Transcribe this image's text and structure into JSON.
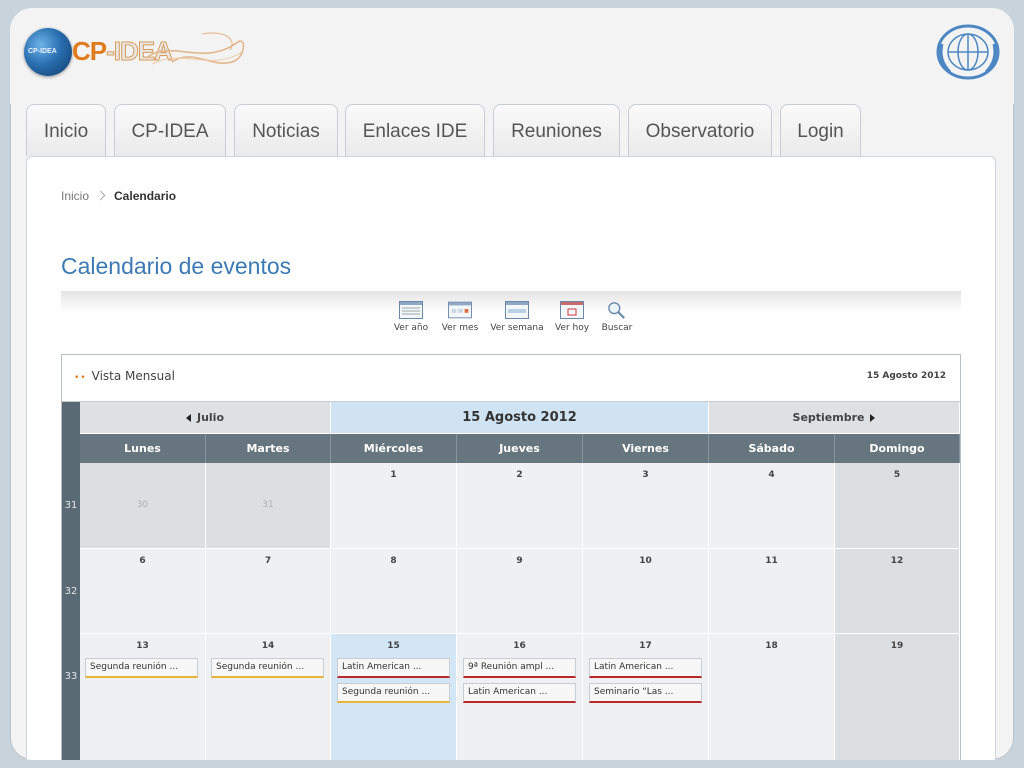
{
  "logo": {
    "globe_text": "CP-IDEA",
    "text_a": "CP",
    "text_b": "-IDEA"
  },
  "nav_tabs": [
    "Inicio",
    "CP-IDEA",
    "Noticias",
    "Enlaces IDE",
    "Reuniones",
    "Observatorio",
    "Login"
  ],
  "breadcrumb": {
    "home": "Inicio",
    "current": "Calendario"
  },
  "page_title": "Calendario de eventos",
  "toolbar": {
    "year": "Ver año",
    "month": "Ver mes",
    "week": "Ver semana",
    "today": "Ver hoy",
    "search": "Buscar"
  },
  "calendar": {
    "view_label": "Vista Mensual",
    "header_date": "15 Agosto 2012",
    "prev_month": "Julio",
    "current_month": "15 Agosto 2012",
    "next_month": "Septiembre",
    "day_names": [
      "Lunes",
      "Martes",
      "Miércoles",
      "Jueves",
      "Viernes",
      "Sábado",
      "Domingo"
    ],
    "weeks": [
      {
        "num": "31",
        "days": [
          "30",
          "31",
          "1",
          "2",
          "3",
          "4",
          "5"
        ]
      },
      {
        "num": "32",
        "days": [
          "6",
          "7",
          "8",
          "9",
          "10",
          "11",
          "12"
        ]
      },
      {
        "num": "33",
        "days": [
          "13",
          "14",
          "15",
          "16",
          "17",
          "18",
          "19"
        ]
      }
    ],
    "events": {
      "mon13": "Segunda reunión ...",
      "tue14": "Segunda reunión ...",
      "wed15a": "Latin American ...",
      "wed15b": "Segunda reunión ...",
      "thu16a": "9ª Reunión ampl ...",
      "thu16b": "Latin American ...",
      "fri17a": "Latin American ...",
      "fri17b": "Seminario “Las ..."
    }
  },
  "colors": {
    "accent": "#3d7ab5",
    "header_dark": "#66757e",
    "today": "#d2e6f6",
    "event_yellow": "#e9b43a",
    "event_red": "#b82a2a"
  }
}
